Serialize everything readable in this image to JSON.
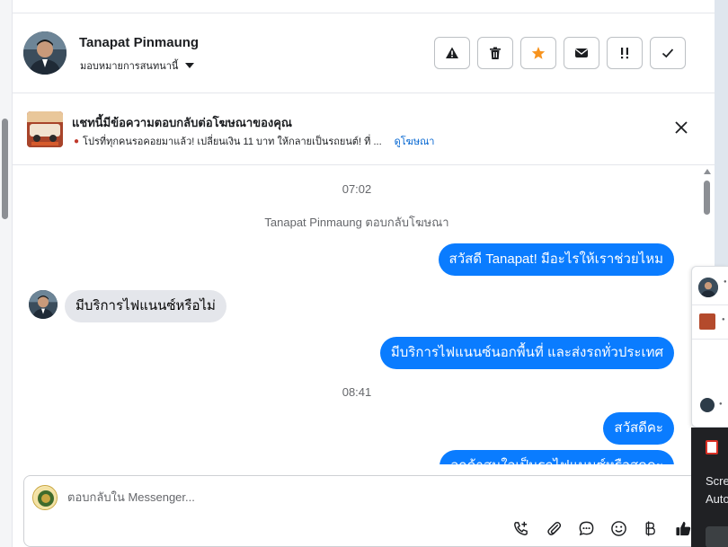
{
  "header": {
    "contact_name": "Tanapat Pinmaung",
    "assign_label": "มอบหมายการสนทนานี้",
    "actions": [
      {
        "name": "report-spam-button",
        "icon": "warning-triangle-icon"
      },
      {
        "name": "delete-button",
        "icon": "trash-icon"
      },
      {
        "name": "star-button",
        "icon": "star-icon"
      },
      {
        "name": "mark-unread-button",
        "icon": "envelope-icon"
      },
      {
        "name": "follow-up-button",
        "icon": "double-exclamation-icon"
      },
      {
        "name": "mark-done-button",
        "icon": "check-icon"
      }
    ]
  },
  "ad_banner": {
    "title": "แชทนี้มีข้อความตอบกลับต่อโฆษณาของคุณ",
    "description": "โปรที่ทุกคนรอคอยมาแล้ว! เปลี่ยนเงิน 11 บาท ให้กลายเป็นรถยนต์! ที่ ...",
    "link_label": "ดูโฆษณา"
  },
  "conversation": {
    "timestamp_1": "07:02",
    "system_note": "Tanapat Pinmaung ตอบกลับโฆษณา",
    "msg_out_1": "สวัสดี Tanapat! มีอะไรให้เราช่วยไหม",
    "msg_in_1": "มีบริการไฟแนนซ์หรือไม่",
    "msg_out_2": "มีบริการไฟแนนซ์นอกพื้นที่ และส่งรถทั่วประเทศ",
    "timestamp_2": "08:41",
    "msg_out_3": "สวัสดีคะ",
    "msg_out_4": "ลูกค้าสนใจเป็นรถไฟแนนซ์หรือสดคะ"
  },
  "composer": {
    "placeholder": "ตอบกลับใน Messenger...",
    "tools": [
      "call-icon",
      "attachment-icon",
      "saved-reply-icon",
      "emoji-icon",
      "baht-payment-icon",
      "thumbs-up-icon"
    ]
  },
  "side_panel": {
    "line_1": "Scre",
    "line_2": "Auto"
  },
  "colors": {
    "brand_blue": "#0a7cff",
    "incoming_gray": "#e4e6eb",
    "star_orange": "#f7931e",
    "link_blue": "#0064d1"
  }
}
